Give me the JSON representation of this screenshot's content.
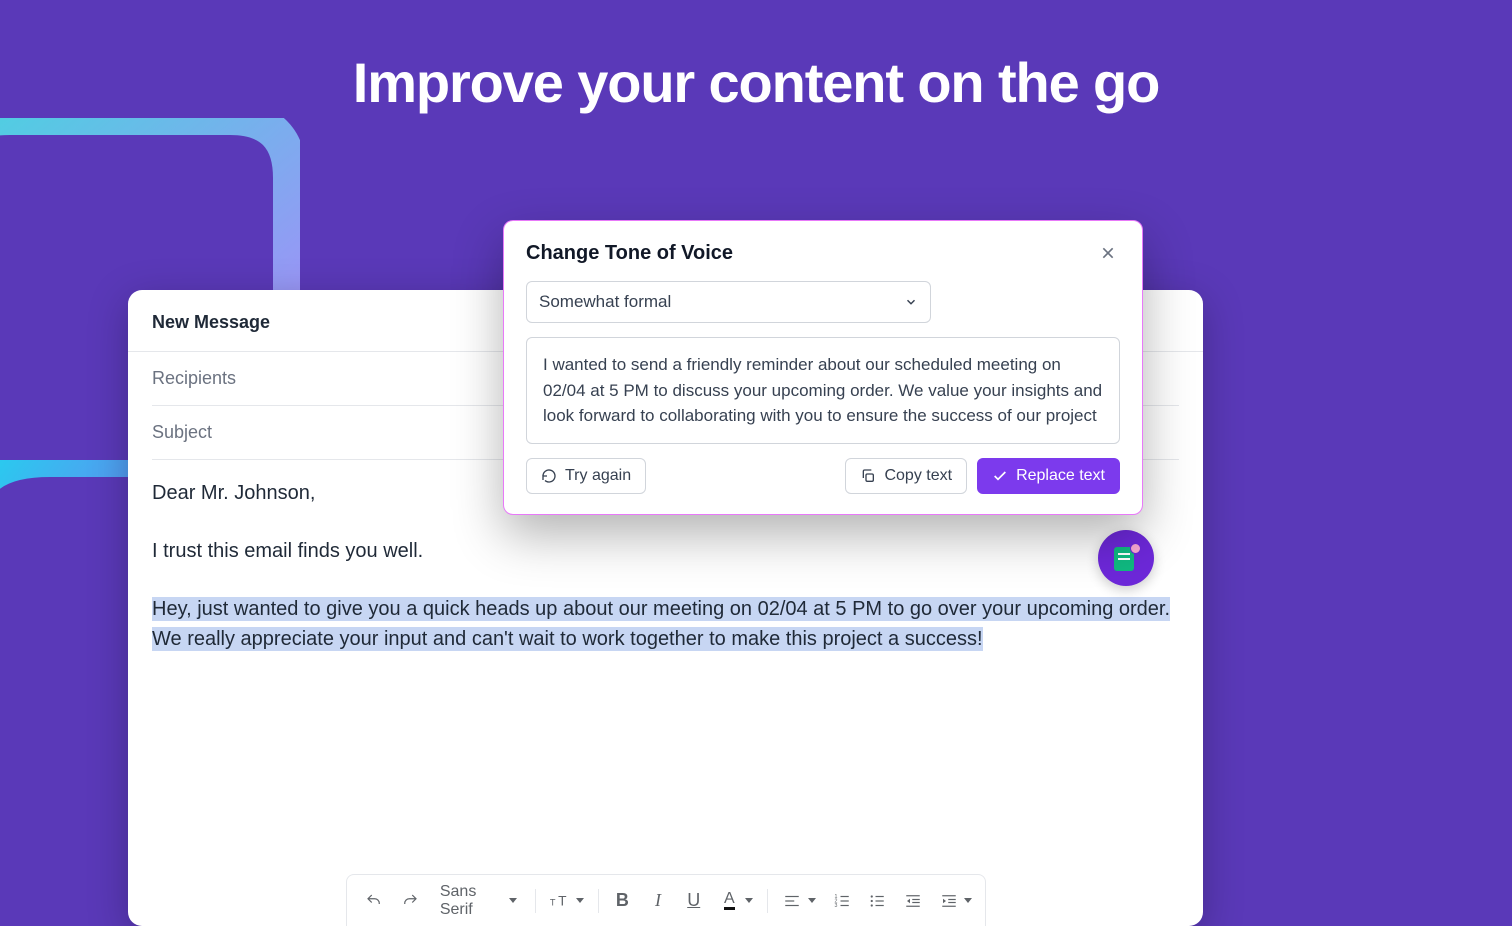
{
  "hero": {
    "title": "Improve your content on the go"
  },
  "email": {
    "window_title": "New Message",
    "recipients_label": "Recipients",
    "subject_label": "Subject",
    "greeting": "Dear Mr. Johnson,",
    "line1": "I trust this email finds you well.",
    "highlighted": "Hey, just wanted to give you a quick heads up about our meeting on 02/04 at 5 PM to go over your upcoming order. We really appreciate your input and can't wait to work together to make this project a success!"
  },
  "toolbar": {
    "font_label": "Sans Serif"
  },
  "popup": {
    "title": "Change Tone of Voice",
    "tone_selected": "Somewhat formal",
    "result_text": "I wanted to send a friendly reminder about our scheduled meeting on 02/04 at 5 PM to discuss your upcoming order. We value your insights and look forward to collaborating with you to ensure the success of our project",
    "try_again_label": "Try again",
    "copy_label": "Copy text",
    "replace_label": "Replace text"
  }
}
